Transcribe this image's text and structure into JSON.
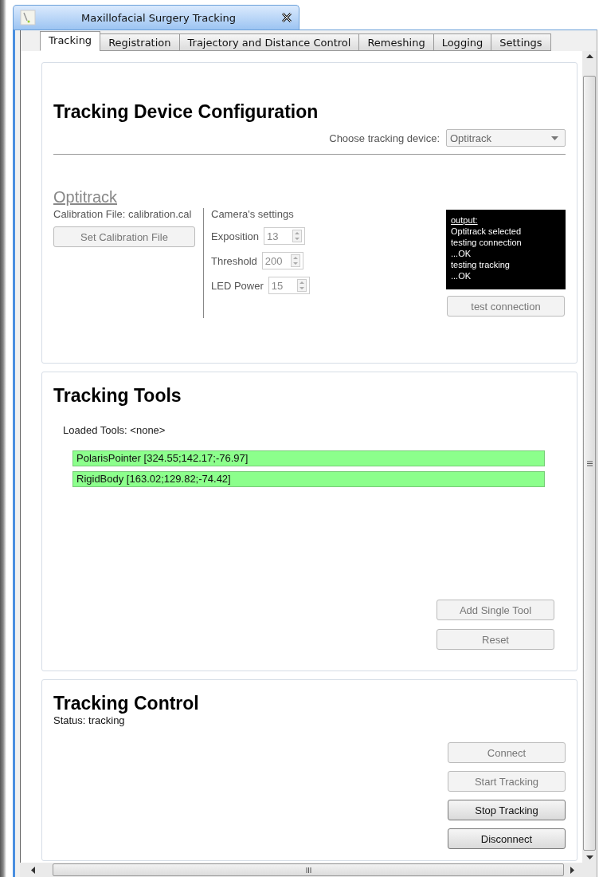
{
  "window": {
    "title": "Maxillofacial Surgery Tracking"
  },
  "tabs": [
    {
      "label": "Tracking",
      "selected": true
    },
    {
      "label": "Registration",
      "selected": false
    },
    {
      "label": "Trajectory and Distance Control",
      "selected": false
    },
    {
      "label": "Remeshing",
      "selected": false
    },
    {
      "label": "Logging",
      "selected": false
    },
    {
      "label": "Settings",
      "selected": false
    }
  ],
  "device_config": {
    "title": "Tracking Device Configuration",
    "device_label": "Choose tracking device:",
    "device_value": "Optitrack",
    "device_name": "Optitrack",
    "calibration_label": "Calibration File: calibration.cal",
    "calibration_button": {
      "label": "Set Calibration File",
      "disabled": true
    },
    "camera_title": "Camera's settings",
    "camera_settings": [
      {
        "label": "Exposition",
        "value": "13"
      },
      {
        "label": "Threshold",
        "value": "200"
      },
      {
        "label": "LED Power",
        "value": "15"
      }
    ],
    "output_lines": [
      {
        "text": "output:",
        "underlined": true
      },
      {
        "text": "Optitrack selected",
        "underlined": false
      },
      {
        "text": "testing connection",
        "underlined": false
      },
      {
        "text": "...OK",
        "underlined": false
      },
      {
        "text": "testing tracking",
        "underlined": false
      },
      {
        "text": "...OK",
        "underlined": false
      }
    ],
    "test_button": {
      "label": "test connection",
      "disabled": true
    }
  },
  "tracking_tools": {
    "title": "Tracking Tools",
    "loaded_label": "Loaded Tools: <none>",
    "tools": [
      {
        "label": "PolarisPointer [324.55;142.17;-76.97]",
        "color": "#8cff8c"
      },
      {
        "label": "RigidBody [163.02;129.82;-74.42]",
        "color": "#8cff8c"
      }
    ],
    "buttons": [
      {
        "label": "Add Single Tool",
        "disabled": true
      },
      {
        "label": "Reset",
        "disabled": true
      }
    ]
  },
  "tracking_control": {
    "title": "Tracking Control",
    "status": "Status: tracking",
    "buttons": [
      {
        "label": "Connect",
        "disabled": true
      },
      {
        "label": "Start Tracking",
        "disabled": true
      },
      {
        "label": "Stop Tracking",
        "disabled": false
      },
      {
        "label": "Disconnect",
        "disabled": false
      }
    ]
  }
}
